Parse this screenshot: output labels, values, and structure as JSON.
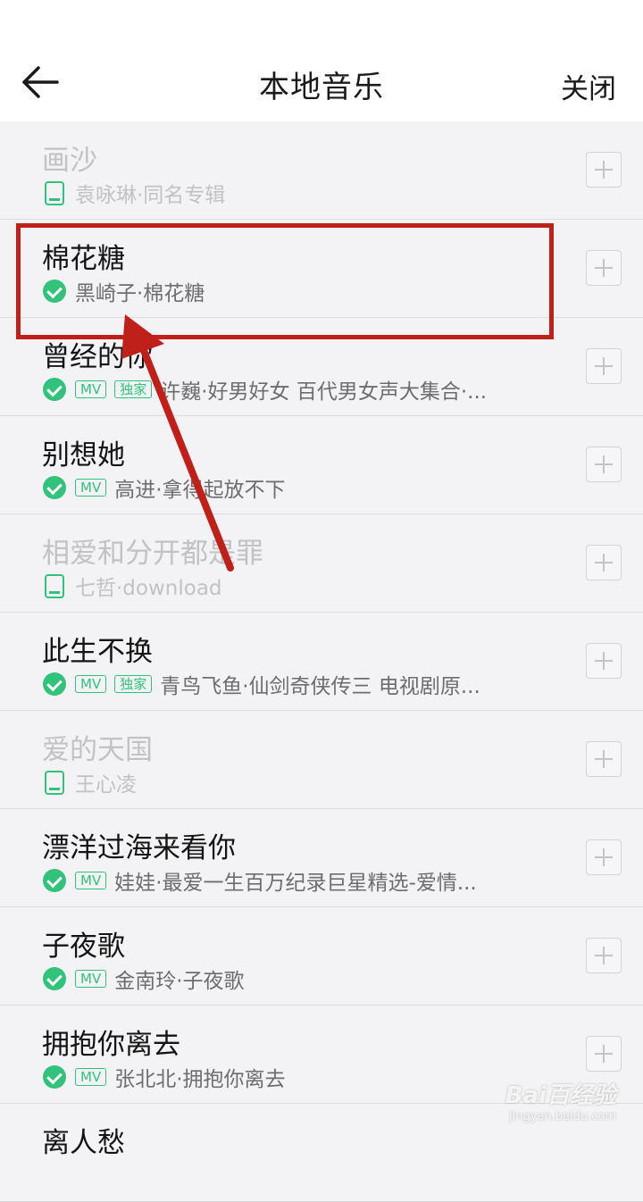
{
  "header": {
    "title": "本地音乐",
    "close_label": "关闭",
    "back_icon": "arrow-left-icon"
  },
  "colors": {
    "accent": "#31c27c",
    "highlight": "#c0201a"
  },
  "songs": [
    {
      "title": "画沙",
      "meta": "袁咏琳·同名专辑",
      "status": "device",
      "dim": true,
      "tags": []
    },
    {
      "title": "棉花糖",
      "meta": "黑崎子·棉花糖",
      "status": "downloaded",
      "dim": false,
      "tags": []
    },
    {
      "title": "曾经的你",
      "meta": "许巍·好男好女 百代男女声大集合·...",
      "status": "downloaded",
      "dim": false,
      "tags": [
        "MV",
        "独家"
      ]
    },
    {
      "title": "别想她",
      "meta": "高进·拿得起放不下",
      "status": "downloaded",
      "dim": false,
      "tags": [
        "MV"
      ]
    },
    {
      "title": "相爱和分开都是罪",
      "meta": "七哲·download",
      "status": "device",
      "dim": true,
      "tags": []
    },
    {
      "title": "此生不换",
      "meta": "青鸟飞鱼·仙剑奇侠传三 电视剧原...",
      "status": "downloaded",
      "dim": false,
      "tags": [
        "MV",
        "独家"
      ]
    },
    {
      "title": " 爱的天国",
      "meta": "王心凌",
      "status": "device",
      "dim": true,
      "tags": []
    },
    {
      "title": "漂洋过海来看你",
      "meta": "娃娃·最爱一生百万纪录巨星精选-爱情...",
      "status": "downloaded",
      "dim": false,
      "tags": [
        "MV"
      ]
    },
    {
      "title": "子夜歌",
      "meta": "金南玲·子夜歌",
      "status": "downloaded",
      "dim": false,
      "tags": [
        "MV"
      ]
    },
    {
      "title": "拥抱你离去",
      "meta": "张北北·拥抱你离去",
      "status": "downloaded",
      "dim": false,
      "tags": [
        "MV"
      ]
    },
    {
      "title": "离人愁",
      "meta": "",
      "status": "none",
      "dim": false,
      "tags": []
    }
  ],
  "watermark": {
    "logo": "Bai百经验",
    "url": "jingyan.baidu.com"
  }
}
